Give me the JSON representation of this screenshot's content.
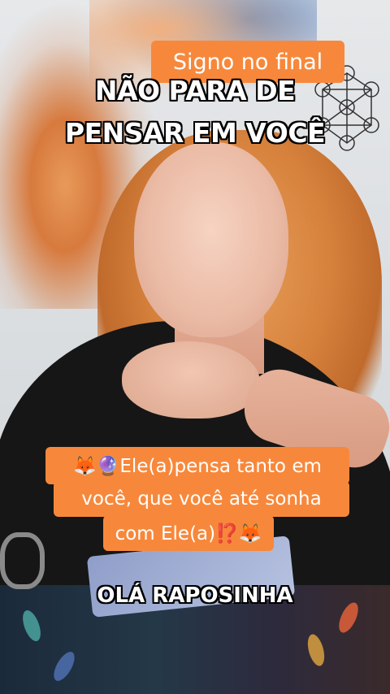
{
  "overlay": {
    "top_caption": "Signo no final",
    "headline_line1": "NÃO PARA DE",
    "headline_line2": "PENSAR EM VOCÊ",
    "bubble_line1": "🦊🔮Ele(a)pensa tanto em",
    "bubble_line2": "você, que você até sonha",
    "bubble_line3": "com Ele(a)⁉️🦊",
    "footer": "OLÁ RAPOSINHA"
  },
  "colors": {
    "caption_bg": "#f7883b",
    "text": "#ffffff",
    "outline": "#000000"
  }
}
